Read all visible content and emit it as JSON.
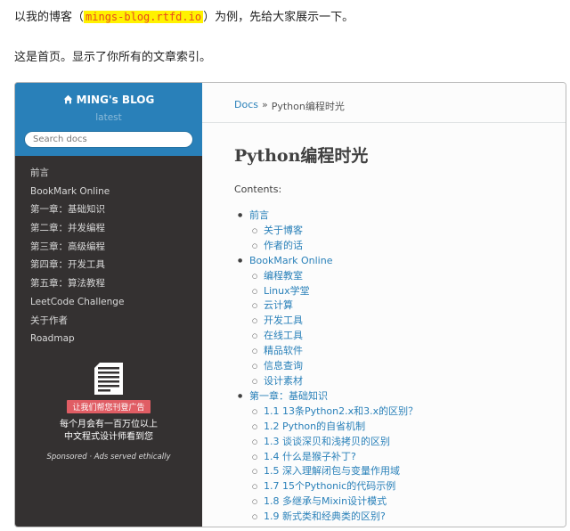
{
  "article": {
    "line1_prefix": "以我的博客（",
    "line1_code": "mings-blog.rtfd.io",
    "line1_suffix": "）为例，先给大家展示一下。",
    "line2": "这是首页。显示了你所有的文章索引。"
  },
  "sidebar": {
    "brand": "MING's BLOG",
    "version": "latest",
    "search_placeholder": "Search docs",
    "items": [
      "前言",
      "BookMark Online",
      "第一章：基础知识",
      "第二章：并发编程",
      "第三章：高级编程",
      "第四章：开发工具",
      "第五章：算法教程",
      "LeetCode Challenge",
      "关于作者",
      "Roadmap"
    ],
    "ad": {
      "button": "让我们帮您刊登广告",
      "line1": "每个月会有一百万位以上",
      "line2": "中文程式设计师看到您",
      "sponsor": "Sponsored · Ads served ethically"
    }
  },
  "main": {
    "breadcrumb_docs": "Docs",
    "breadcrumb_sep": "»",
    "breadcrumb_current": "Python编程时光",
    "title": "Python编程时光",
    "contents_label": "Contents:",
    "toc": [
      {
        "label": "前言",
        "children": [
          "关于博客",
          "作者的话"
        ]
      },
      {
        "label": "BookMark Online",
        "children": [
          "编程教室",
          "Linux学堂",
          "云计算",
          "开发工具",
          "在线工具",
          "精品软件",
          "信息查询",
          "设计素材"
        ]
      },
      {
        "label": "第一章：基础知识",
        "children": [
          "1.1 13条Python2.x和3.x的区别？",
          "1.2 Python的自省机制",
          "1.3 谈谈深贝和浅拷贝的区别",
          "1.4 什么是猴子补丁?",
          "1.5 深入理解闭包与变量作用域",
          "1.7 15个Pythonic的代码示例",
          "1.8 多继承与Mixin设计模式",
          "1.9 新式类和经典类的区别?"
        ]
      }
    ]
  }
}
